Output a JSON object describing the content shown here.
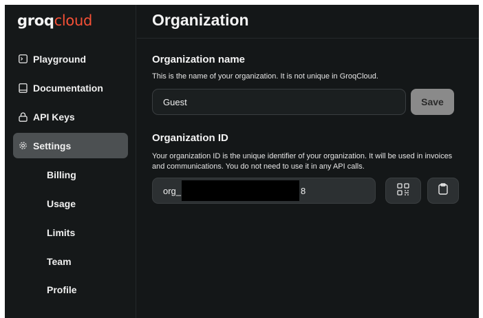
{
  "logo": {
    "brand_bold": "groq",
    "brand_light": "cloud"
  },
  "sidebar": {
    "items": [
      {
        "label": "Playground",
        "icon": "terminal-icon"
      },
      {
        "label": "Documentation",
        "icon": "book-icon"
      },
      {
        "label": "API Keys",
        "icon": "lock-icon"
      },
      {
        "label": "Settings",
        "icon": "gear-icon",
        "active": true
      }
    ],
    "subitems": [
      {
        "label": "Billing"
      },
      {
        "label": "Usage"
      },
      {
        "label": "Limits"
      },
      {
        "label": "Team"
      },
      {
        "label": "Profile"
      }
    ]
  },
  "main": {
    "title": "Organization",
    "org_name": {
      "heading": "Organization name",
      "description": "This is the name of your organization. It is not unique in GroqCloud.",
      "value": "Guest",
      "save_label": "Save"
    },
    "org_id": {
      "heading": "Organization ID",
      "description": "Your organization ID is the unique identifier of your organization. It will be used in invoices and communications. You do not need to use it in any API calls.",
      "prefix": "org_",
      "suffix": "8",
      "qr_icon": "qr-code-icon",
      "copy_icon": "clipboard-icon"
    }
  },
  "colors": {
    "background": "#151819",
    "active_nav": "#4c5052",
    "accent": "#f55036",
    "save_button": "#8a8a8a"
  }
}
